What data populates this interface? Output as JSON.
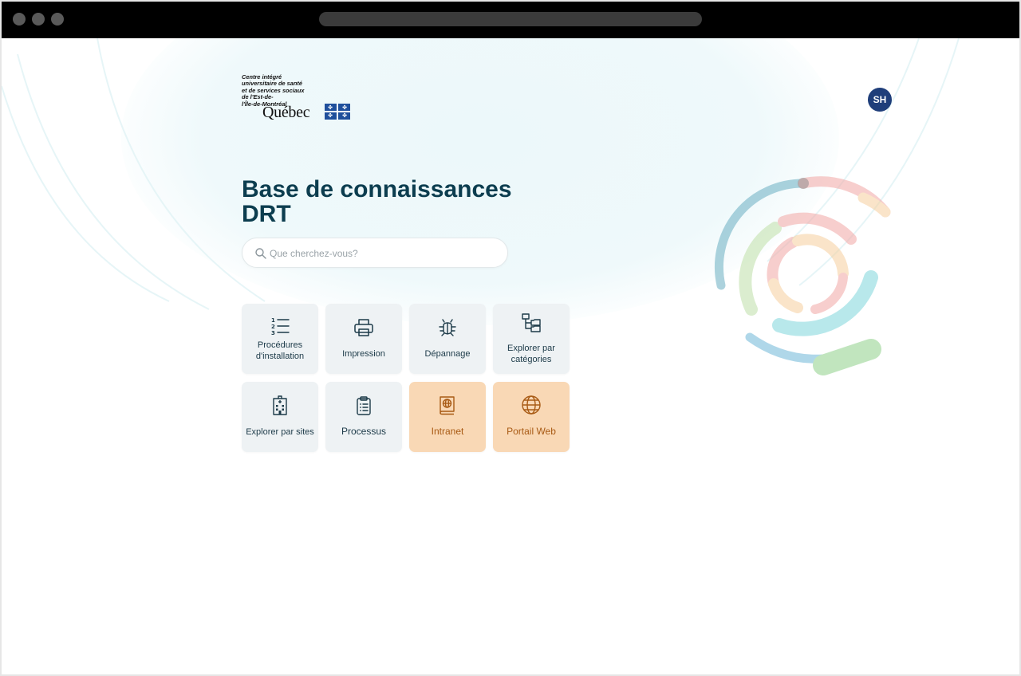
{
  "browser": {
    "url_bar": ""
  },
  "logo": {
    "org_lines": "Centre intégré\nuniversitaire de santé\net de services sociaux\nde l'Est-de-\nl'Île-de-Montréal",
    "wordmark": "Québec"
  },
  "user": {
    "initials": "SH"
  },
  "page": {
    "title_line1": "Base de connaissances",
    "title_line2": "DRT"
  },
  "search": {
    "placeholder": "Que cherchez-vous?",
    "value": ""
  },
  "tiles": [
    {
      "label_line1": "Procédures",
      "label_line2": "d'installation",
      "icon": "numbered-list-icon"
    },
    {
      "label_line1": "Impression",
      "label_line2": "",
      "icon": "printer-icon"
    },
    {
      "label_line1": "Dépannage",
      "label_line2": "",
      "icon": "bug-icon"
    },
    {
      "label_line1": "Explorer par",
      "label_line2": "catégories",
      "icon": "folder-tree-icon"
    },
    {
      "label_line1": "Explorer par sites",
      "label_line2": "",
      "icon": "building-icon"
    },
    {
      "label_line1": "Processus",
      "label_line2": "",
      "icon": "clipboard-icon"
    },
    {
      "label_line1": "Intranet",
      "label_line2": "",
      "icon": "book-globe-icon"
    },
    {
      "label_line1": "Portail Web",
      "label_line2": "",
      "icon": "globe-icon"
    }
  ],
  "colors": {
    "title": "#0c3d4f",
    "avatar": "#1f3e7a",
    "tile_bg": "#eef2f4",
    "tile_accent_bg": "#f9d8b5",
    "tile_accent_text": "#a85a14"
  }
}
